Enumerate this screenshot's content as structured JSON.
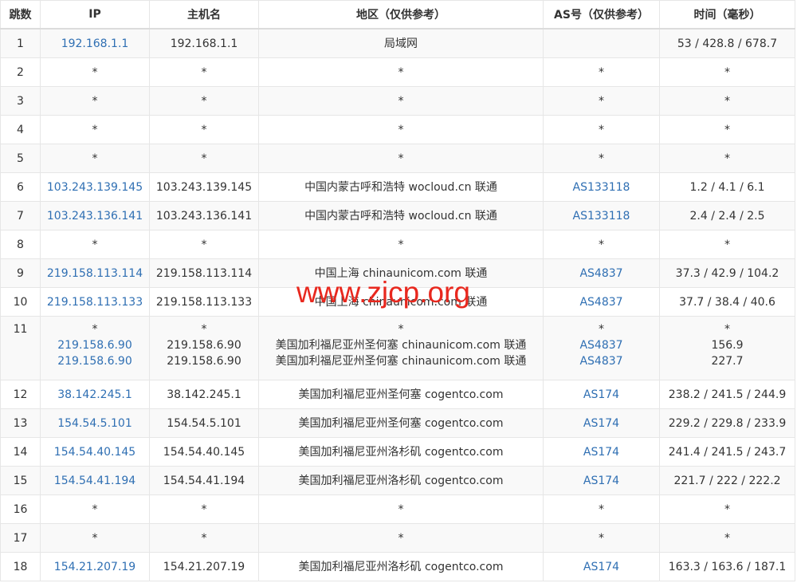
{
  "table": {
    "headers": [
      "跳数",
      "IP",
      "主机名",
      "地区（仅供参考）",
      "AS号（仅供参考）",
      "时间（毫秒）"
    ],
    "rows": [
      {
        "hop": "1",
        "ip": [
          "192.168.1.1"
        ],
        "host": [
          "192.168.1.1"
        ],
        "region": [
          "局域网"
        ],
        "as": [
          ""
        ],
        "time": [
          "53 / 428.8 / 678.7"
        ]
      },
      {
        "hop": "2",
        "ip": [
          "*"
        ],
        "host": [
          "*"
        ],
        "region": [
          "*"
        ],
        "as": [
          "*"
        ],
        "time": [
          "*"
        ]
      },
      {
        "hop": "3",
        "ip": [
          "*"
        ],
        "host": [
          "*"
        ],
        "region": [
          "*"
        ],
        "as": [
          "*"
        ],
        "time": [
          "*"
        ]
      },
      {
        "hop": "4",
        "ip": [
          "*"
        ],
        "host": [
          "*"
        ],
        "region": [
          "*"
        ],
        "as": [
          "*"
        ],
        "time": [
          "*"
        ]
      },
      {
        "hop": "5",
        "ip": [
          "*"
        ],
        "host": [
          "*"
        ],
        "region": [
          "*"
        ],
        "as": [
          "*"
        ],
        "time": [
          "*"
        ]
      },
      {
        "hop": "6",
        "ip": [
          "103.243.139.145"
        ],
        "host": [
          "103.243.139.145"
        ],
        "region": [
          "中国内蒙古呼和浩特 wocloud.cn 联通"
        ],
        "as": [
          "AS133118"
        ],
        "time": [
          "1.2 / 4.1 / 6.1"
        ]
      },
      {
        "hop": "7",
        "ip": [
          "103.243.136.141"
        ],
        "host": [
          "103.243.136.141"
        ],
        "region": [
          "中国内蒙古呼和浩特 wocloud.cn 联通"
        ],
        "as": [
          "AS133118"
        ],
        "time": [
          "2.4 / 2.4 / 2.5"
        ]
      },
      {
        "hop": "8",
        "ip": [
          "*"
        ],
        "host": [
          "*"
        ],
        "region": [
          "*"
        ],
        "as": [
          "*"
        ],
        "time": [
          "*"
        ]
      },
      {
        "hop": "9",
        "ip": [
          "219.158.113.114"
        ],
        "host": [
          "219.158.113.114"
        ],
        "region": [
          "中国上海 chinaunicom.com 联通"
        ],
        "as": [
          "AS4837"
        ],
        "time": [
          "37.3 / 42.9 / 104.2"
        ]
      },
      {
        "hop": "10",
        "ip": [
          "219.158.113.133"
        ],
        "host": [
          "219.158.113.133"
        ],
        "region": [
          "中国上海 chinaunicom.com 联通"
        ],
        "as": [
          "AS4837"
        ],
        "time": [
          "37.7 / 38.4 / 40.6"
        ]
      },
      {
        "hop": "11",
        "ip": [
          "*",
          "219.158.6.90",
          "219.158.6.90"
        ],
        "host": [
          "*",
          "219.158.6.90",
          "219.158.6.90"
        ],
        "region": [
          "*",
          "美国加利福尼亚州圣何塞 chinaunicom.com 联通",
          "美国加利福尼亚州圣何塞 chinaunicom.com 联通"
        ],
        "as": [
          "*",
          "AS4837",
          "AS4837"
        ],
        "time": [
          "*",
          "156.9",
          "227.7"
        ]
      },
      {
        "hop": "12",
        "ip": [
          "38.142.245.1"
        ],
        "host": [
          "38.142.245.1"
        ],
        "region": [
          "美国加利福尼亚州圣何塞 cogentco.com"
        ],
        "as": [
          "AS174"
        ],
        "time": [
          "238.2 / 241.5 / 244.9"
        ]
      },
      {
        "hop": "13",
        "ip": [
          "154.54.5.101"
        ],
        "host": [
          "154.54.5.101"
        ],
        "region": [
          "美国加利福尼亚州圣何塞 cogentco.com"
        ],
        "as": [
          "AS174"
        ],
        "time": [
          "229.2 / 229.8 / 233.9"
        ]
      },
      {
        "hop": "14",
        "ip": [
          "154.54.40.145"
        ],
        "host": [
          "154.54.40.145"
        ],
        "region": [
          "美国加利福尼亚州洛杉矶 cogentco.com"
        ],
        "as": [
          "AS174"
        ],
        "time": [
          "241.4 / 241.5 / 243.7"
        ]
      },
      {
        "hop": "15",
        "ip": [
          "154.54.41.194"
        ],
        "host": [
          "154.54.41.194"
        ],
        "region": [
          "美国加利福尼亚州洛杉矶 cogentco.com"
        ],
        "as": [
          "AS174"
        ],
        "time": [
          "221.7 / 222 / 222.2"
        ]
      },
      {
        "hop": "16",
        "ip": [
          "*"
        ],
        "host": [
          "*"
        ],
        "region": [
          "*"
        ],
        "as": [
          "*"
        ],
        "time": [
          "*"
        ]
      },
      {
        "hop": "17",
        "ip": [
          "*"
        ],
        "host": [
          "*"
        ],
        "region": [
          "*"
        ],
        "as": [
          "*"
        ],
        "time": [
          "*"
        ]
      },
      {
        "hop": "18",
        "ip": [
          "154.21.207.19"
        ],
        "host": [
          "154.21.207.19"
        ],
        "region": [
          "美国加利福尼亚州洛杉矶 cogentco.com"
        ],
        "as": [
          "AS174"
        ],
        "time": [
          "163.3 / 163.6 / 187.1"
        ]
      }
    ]
  },
  "watermark": "www.zjcp.org",
  "colors": {
    "link": "#2f6fb3",
    "watermark": "#e8281e",
    "stripe": "#f9f9f9"
  }
}
